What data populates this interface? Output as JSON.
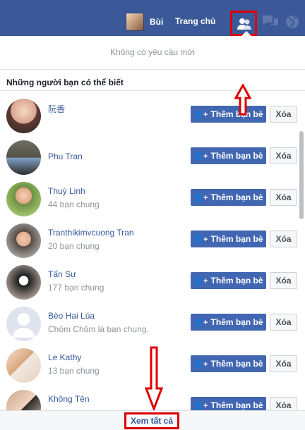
{
  "header": {
    "user_name": "Bùi",
    "home_label": "Trang chủ"
  },
  "notifications": {
    "empty_text": "Không có yêu cầu mới"
  },
  "suggestions": {
    "title": "Những người bạn có thể biết",
    "add_label": "Thêm bạn bè",
    "delete_label": "Xóa",
    "people": [
      {
        "name": "阮香",
        "mutual": ""
      },
      {
        "name": "Phu Tran",
        "mutual": ""
      },
      {
        "name": "Thuỳ Linh",
        "mutual": "44 bạn chung"
      },
      {
        "name": "Tranthikimvcuong Tran",
        "mutual": "20 bạn chung"
      },
      {
        "name": "Tấn Sự",
        "mutual": "177 bạn chung"
      },
      {
        "name": "Bèo Hai Lúa",
        "mutual": "Chôm Chôm là bạn chung."
      },
      {
        "name": "Le Kathy",
        "mutual": "13 bạn chung"
      },
      {
        "name": "Không Tên",
        "mutual": ""
      }
    ]
  },
  "footer": {
    "see_all": "Xem tất cả"
  },
  "colors": {
    "top_bar": "#3b5998",
    "primary_button": "#4267b2",
    "annotation": "#dd0000"
  }
}
